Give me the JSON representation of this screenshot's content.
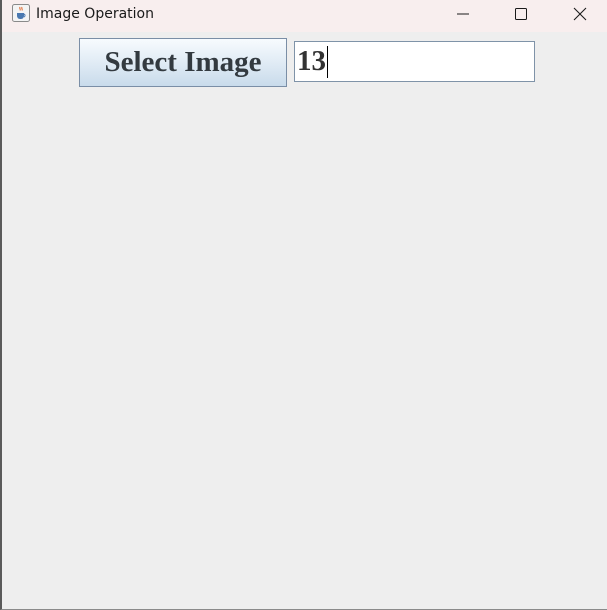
{
  "window": {
    "title": "Image Operation",
    "app_icon": "java-cup-icon",
    "controls": [
      "minimize-icon",
      "maximize-icon",
      "close-icon"
    ]
  },
  "toolbar": {
    "select_image_label": "Select Image"
  },
  "input": {
    "value": "13"
  },
  "colors": {
    "window_background": "#eeeeee",
    "titlebar_background": "#f8eeee",
    "button_border": "#7a8ea6",
    "button_text": "#333a40"
  }
}
